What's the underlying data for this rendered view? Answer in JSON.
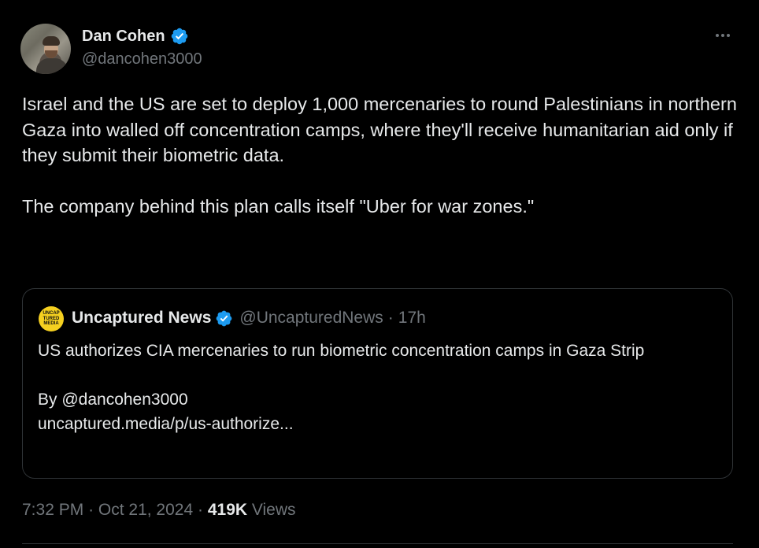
{
  "author": {
    "display_name": "Dan Cohen",
    "handle": "@dancohen3000",
    "verified_icon": "verified-badge-icon"
  },
  "more_icon": "more-horizontal-icon",
  "tweet": {
    "text": "Israel and the US are set to deploy 1,000 mercenaries to round Palestinians in northern Gaza into walled off concentration camps, where they'll receive humanitarian aid only if they submit their biometric data.\n\nThe company behind this plan calls itself \"Uber for war zones.\""
  },
  "quoted": {
    "avatar_text": "UNCAP\nTURED\nMEDIA",
    "display_name": "Uncaptured News",
    "handle": "@UncapturedNews",
    "separator": "·",
    "time": "17h",
    "text": "US authorizes CIA mercenaries to run biometric concentration camps in Gaza Strip\n\nBy @dancohen3000\nuncaptured.media/p/us-authorize..."
  },
  "meta": {
    "time": "7:32 PM",
    "sep1": "·",
    "date": "Oct 21, 2024",
    "sep2": "·",
    "views_count": "419K",
    "views_label": "Views"
  },
  "colors": {
    "background": "#000000",
    "text": "#e7e9ea",
    "muted": "#71767b",
    "border": "#2f3336",
    "verified": "#1d9bf0"
  }
}
